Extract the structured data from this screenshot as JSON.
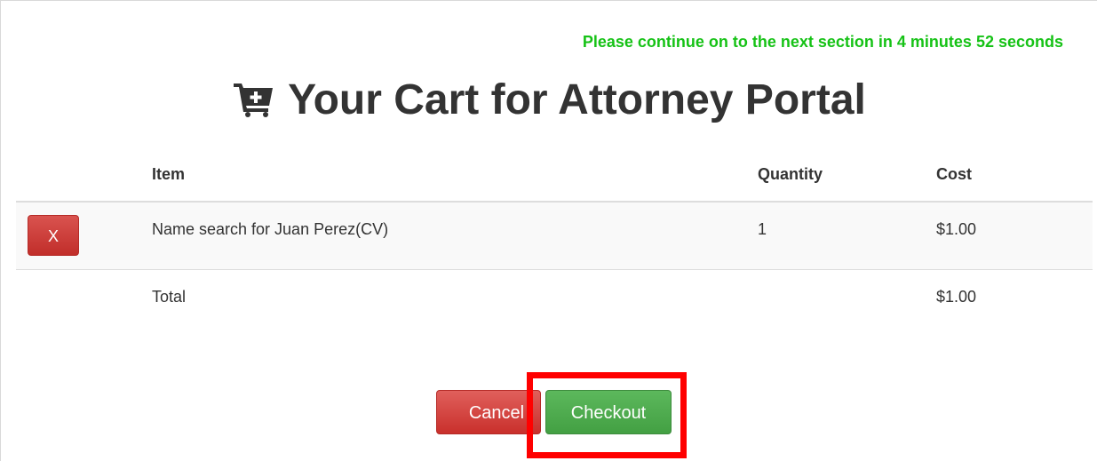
{
  "countdown_text": "Please continue on to the next section in 4 minutes 52 seconds",
  "title": "Your Cart for Attorney Portal",
  "table": {
    "headers": {
      "item": "Item",
      "quantity": "Quantity",
      "cost": "Cost"
    },
    "rows": [
      {
        "delete_label": "X",
        "item": "Name search for Juan Perez(CV)",
        "quantity": "1",
        "cost": "$1.00"
      }
    ],
    "total": {
      "label": "Total",
      "cost": "$1.00"
    }
  },
  "actions": {
    "cancel_label": "Cancel",
    "checkout_label": "Checkout"
  },
  "icons": {
    "title_icon": "cart-plus-icon"
  },
  "colors": {
    "countdown": "#16c216",
    "danger": "#d9534f",
    "success": "#5cb85c",
    "highlight": "#ff0000"
  }
}
